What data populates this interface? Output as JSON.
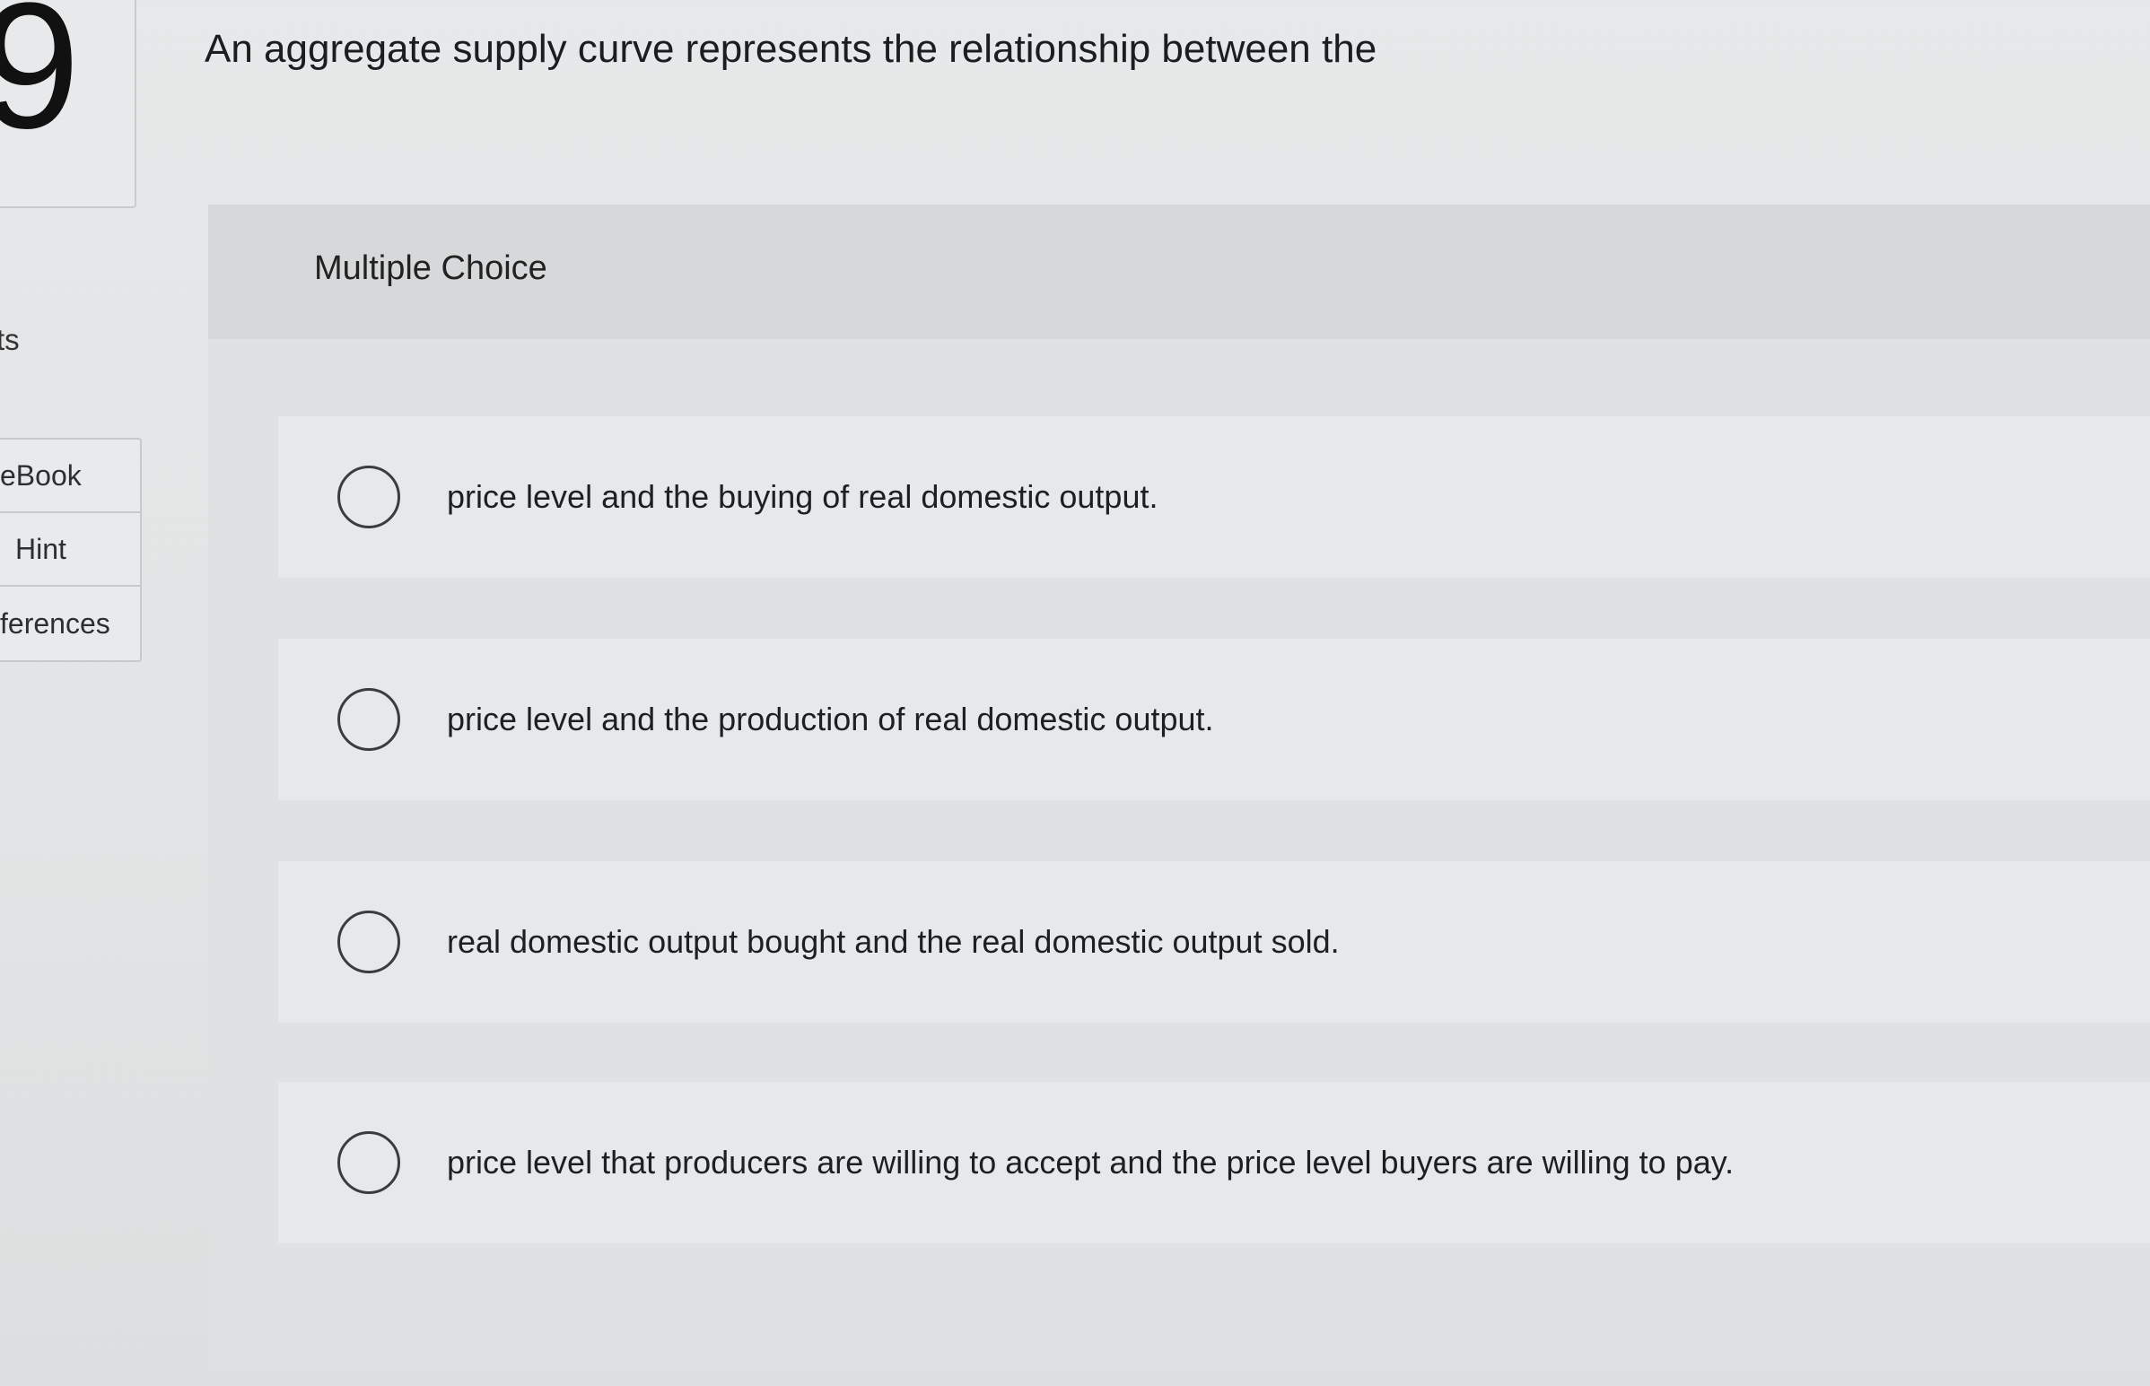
{
  "sidebar": {
    "question_number": "9",
    "points_label": "ts",
    "tabs": [
      {
        "label": "eBook"
      },
      {
        "label": "Hint"
      },
      {
        "label": "ferences"
      }
    ]
  },
  "question": {
    "text": "An aggregate supply curve represents the relationship between the"
  },
  "multiple_choice": {
    "label": "Multiple Choice",
    "options": [
      {
        "text": "price level and the buying of real domestic output."
      },
      {
        "text": "price level and the production of real domestic output."
      },
      {
        "text": "real domestic output bought and the real domestic output sold."
      },
      {
        "text": "price level that producers are willing to accept and the price level buyers are willing to pay."
      }
    ]
  }
}
